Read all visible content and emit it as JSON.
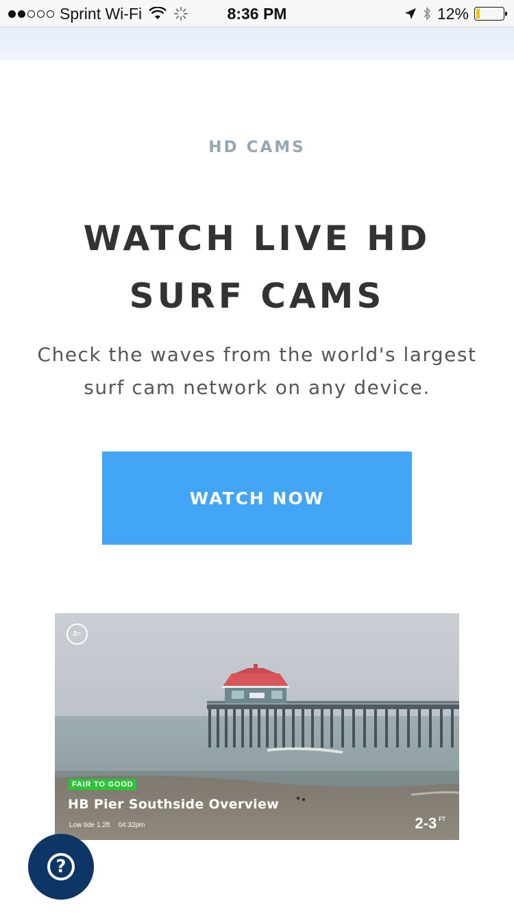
{
  "status_bar": {
    "carrier": "Sprint Wi-Fi",
    "time": "8:36 PM",
    "battery": "12%",
    "battery_level": 0.12,
    "signal_bars_filled": 2,
    "signal_bars_total": 5
  },
  "hero": {
    "eyebrow": "HD CAMS",
    "headline": "WATCH LIVE HD SURF CAMS",
    "subtext": "Check the waves from the world's largest surf cam network on any device.",
    "cta_label": "WATCH NOW"
  },
  "cam_card": {
    "wave_badge": "2",
    "wave_badge_unit": "FT",
    "rating": "FAIR TO GOOD",
    "title": "HB Pier Southside Overview",
    "tide": "Low tide 1.2ft",
    "tide_time": "04:32pm",
    "surf_height": "2-3",
    "surf_height_unit": "FT"
  },
  "help": {
    "icon": "question-mark-icon",
    "glyph": "?"
  },
  "colors": {
    "cta": "#42a5f5",
    "headline": "#333333",
    "eyebrow": "#94a7b2",
    "rating_badge": "#2ac537",
    "help_button": "#0d3566"
  }
}
